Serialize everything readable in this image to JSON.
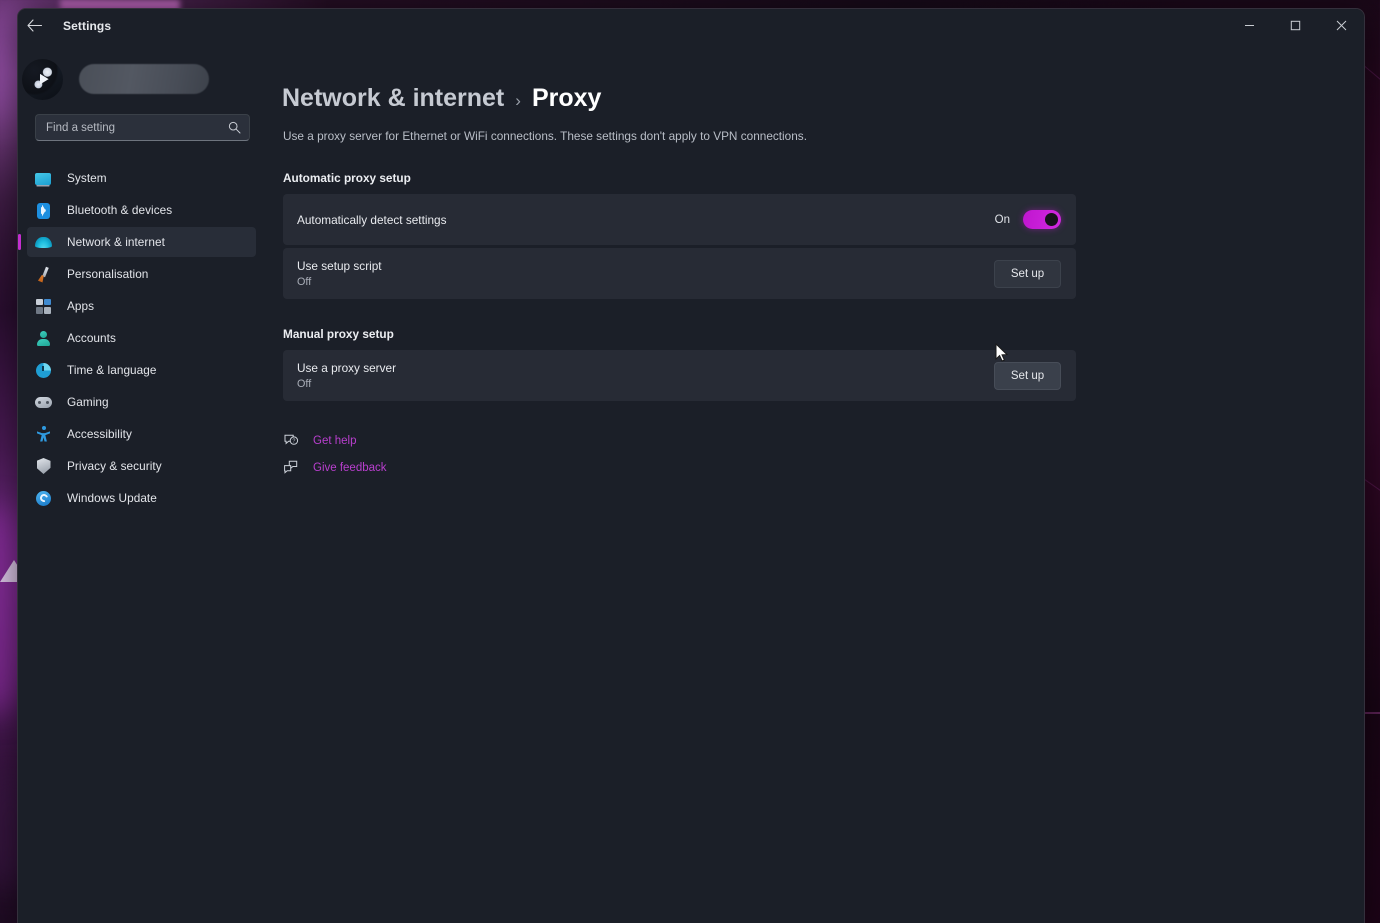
{
  "window": {
    "title": "Settings",
    "back_icon": "back-arrow-icon",
    "minimize_label": "−",
    "maximize_label": "□",
    "close_label": "✕"
  },
  "sidebar": {
    "account_name_redacted": "",
    "search": {
      "placeholder": "Find a setting",
      "value": "",
      "icon": "search-icon"
    },
    "items": [
      {
        "label": "System",
        "icon": "system-icon",
        "selected": false
      },
      {
        "label": "Bluetooth & devices",
        "icon": "bluetooth-icon",
        "selected": false
      },
      {
        "label": "Network & internet",
        "icon": "network-wifi-icon",
        "selected": true
      },
      {
        "label": "Personalisation",
        "icon": "paintbrush-icon",
        "selected": false
      },
      {
        "label": "Apps",
        "icon": "apps-grid-icon",
        "selected": false
      },
      {
        "label": "Accounts",
        "icon": "account-person-icon",
        "selected": false
      },
      {
        "label": "Time & language",
        "icon": "clock-icon",
        "selected": false
      },
      {
        "label": "Gaming",
        "icon": "gamepad-icon",
        "selected": false
      },
      {
        "label": "Accessibility",
        "icon": "accessibility-icon",
        "selected": false
      },
      {
        "label": "Privacy & security",
        "icon": "shield-icon",
        "selected": false
      },
      {
        "label": "Windows Update",
        "icon": "update-refresh-icon",
        "selected": false
      }
    ]
  },
  "main": {
    "breadcrumb": {
      "parent": "Network & internet",
      "separator": "›",
      "current": "Proxy"
    },
    "subtitle": "Use a proxy server for Ethernet or WiFi connections. These settings don't apply to VPN connections.",
    "sections": [
      {
        "heading": "Automatic proxy setup",
        "rows": [
          {
            "title": "Automatically detect settings",
            "sub": "",
            "control": "toggle",
            "toggle_state_label": "On",
            "toggle_on": true
          },
          {
            "title": "Use setup script",
            "sub": "Off",
            "control": "button",
            "button_label": "Set up",
            "hover": false
          }
        ]
      },
      {
        "heading": "Manual proxy setup",
        "rows": [
          {
            "title": "Use a proxy server",
            "sub": "Off",
            "control": "button",
            "button_label": "Set up",
            "hover": true
          }
        ]
      }
    ],
    "links": [
      {
        "label": "Get help",
        "icon": "help-question-icon"
      },
      {
        "label": "Give feedback",
        "icon": "feedback-chat-icon"
      }
    ]
  },
  "colors": {
    "accent": "#c42ed0",
    "toggle_on": "#c815d4",
    "link": "#b93fce",
    "card_bg": "#272b35",
    "window_bg": "#1b1f28"
  }
}
